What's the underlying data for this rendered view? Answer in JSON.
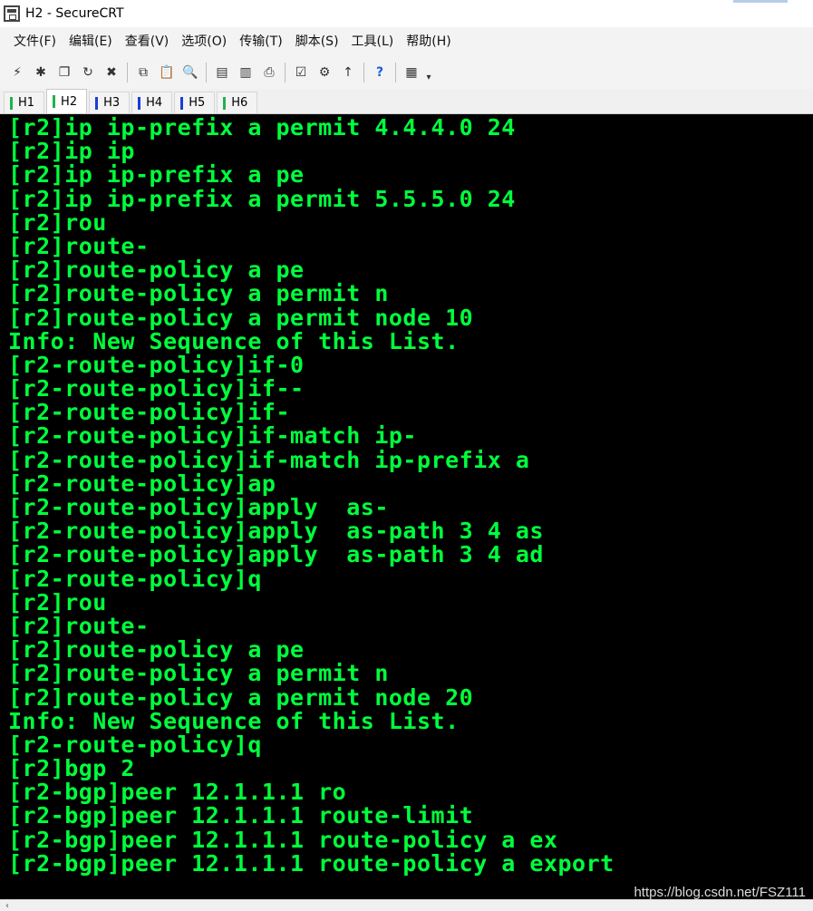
{
  "window": {
    "title": "H2 - SecureCRT"
  },
  "menu": [
    "文件(F)",
    "编辑(E)",
    "查看(V)",
    "选项(O)",
    "传输(T)",
    "脚本(S)",
    "工具(L)",
    "帮助(H)"
  ],
  "toolbar": {
    "buttons": [
      {
        "name": "connect-icon",
        "glyph": "⚡"
      },
      {
        "name": "quick-connect-icon",
        "glyph": "✱"
      },
      {
        "name": "connect-in-tab-icon",
        "glyph": "❐"
      },
      {
        "name": "reconnect-icon",
        "glyph": "↻"
      },
      {
        "name": "disconnect-icon",
        "glyph": "✖"
      },
      {
        "name": "copy-icon",
        "glyph": "⧉"
      },
      {
        "name": "paste-icon",
        "glyph": "📋"
      },
      {
        "name": "find-icon",
        "glyph": "🔍"
      },
      {
        "name": "print-setup-icon",
        "glyph": "▤"
      },
      {
        "name": "print-selection-icon",
        "glyph": "▥"
      },
      {
        "name": "print-icon",
        "glyph": "⎙"
      },
      {
        "name": "session-options-icon",
        "glyph": "☑"
      },
      {
        "name": "global-options-icon",
        "glyph": "⚙"
      },
      {
        "name": "keymap-icon",
        "glyph": "↑"
      },
      {
        "name": "help-icon",
        "glyph": "?"
      },
      {
        "name": "sftp-icon",
        "glyph": "▦"
      }
    ]
  },
  "tabs": [
    {
      "label": "H1",
      "color": "#22b14c",
      "active": false
    },
    {
      "label": "H2",
      "color": "#22b14c",
      "active": true
    },
    {
      "label": "H3",
      "color": "#1a3fd6",
      "active": false
    },
    {
      "label": "H4",
      "color": "#1a3fd6",
      "active": false
    },
    {
      "label": "H5",
      "color": "#1a3fd6",
      "active": false
    },
    {
      "label": "H6",
      "color": "#22b14c",
      "active": false
    }
  ],
  "terminal": {
    "text_color": "#00ff3c",
    "lines": [
      "[r2]ip ip-prefix a permit 4.4.4.0 24",
      "[r2]ip ip",
      "[r2]ip ip-prefix a pe",
      "[r2]ip ip-prefix a permit 5.5.5.0 24",
      "[r2]rou",
      "[r2]route-",
      "[r2]route-policy a pe",
      "[r2]route-policy a permit n",
      "[r2]route-policy a permit node 10",
      "Info: New Sequence of this List.",
      "[r2-route-policy]if-0",
      "[r2-route-policy]if--",
      "[r2-route-policy]if-",
      "[r2-route-policy]if-match ip-",
      "[r2-route-policy]if-match ip-prefix a",
      "[r2-route-policy]ap",
      "[r2-route-policy]apply  as-",
      "[r2-route-policy]apply  as-path 3 4 as",
      "[r2-route-policy]apply  as-path 3 4 ad",
      "[r2-route-policy]q",
      "[r2]rou",
      "[r2]route-",
      "[r2]route-policy a pe",
      "[r2]route-policy a permit n",
      "[r2]route-policy a permit node 20",
      "Info: New Sequence of this List.",
      "[r2-route-policy]q",
      "[r2]bgp 2",
      "[r2-bgp]peer 12.1.1.1 ro",
      "[r2-bgp]peer 12.1.1.1 route-limit",
      "[r2-bgp]peer 12.1.1.1 route-policy a ex",
      "[r2-bgp]peer 12.1.1.1 route-policy a export"
    ]
  },
  "watermark": "https://blog.csdn.net/FSZ111",
  "scrollbar": {
    "left_arrow": "‹"
  }
}
